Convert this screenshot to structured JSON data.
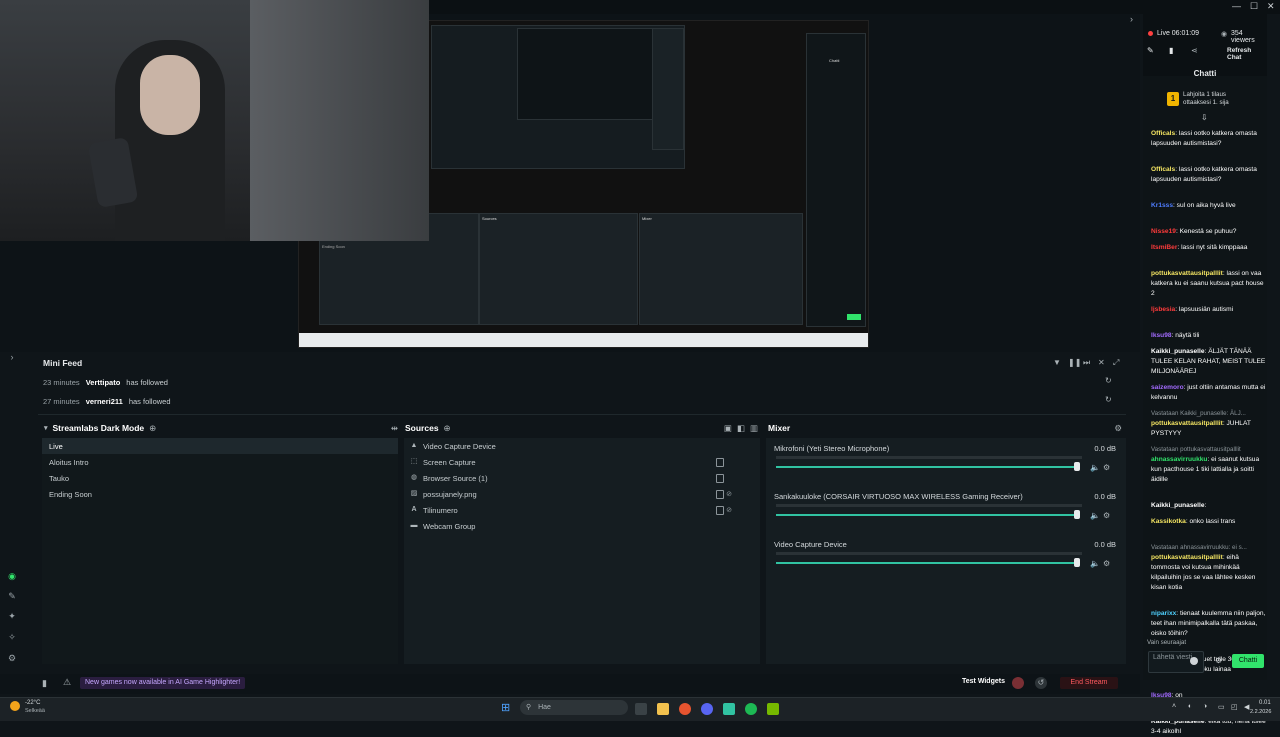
{
  "preview": {
    "thumb_scene_label": "Ending Soon",
    "thumb_sources_label": "Sources",
    "thumb_mixer_label": "Mixer",
    "thumb_chat_label": "Chatti"
  },
  "minifeed": {
    "title": "Mini Feed",
    "events": [
      {
        "time": "23 minutes",
        "name": "Verttipato",
        "action": "has followed"
      },
      {
        "time": "27 minutes",
        "name": "verneri211",
        "action": "has followed"
      }
    ]
  },
  "scenes": {
    "title": "Streamlabs Dark Mode",
    "items": [
      "Live",
      "Aloitus Intro",
      "Tauko",
      "Ending Soon"
    ]
  },
  "sources": {
    "title": "Sources",
    "items": [
      {
        "label": "Video Capture Device",
        "icon": "webcam-icon"
      },
      {
        "label": "Screen Capture",
        "icon": "screen-icon"
      },
      {
        "label": "Browser Source (1)",
        "icon": "browser-icon"
      },
      {
        "label": "possujanely.png",
        "icon": "image-icon"
      },
      {
        "label": "Tilinumero",
        "icon": "text-icon"
      },
      {
        "label": "Webcam Group",
        "icon": "folder-icon"
      }
    ]
  },
  "mixer": {
    "title": "Mixer",
    "channels": [
      {
        "name": "Mikrofoni (Yeti Stereo Microphone)",
        "db": "0.0 dB",
        "level": 0.98
      },
      {
        "name": "Sankakuuloke (CORSAIR VIRTUOSO MAX WIRELESS Gaming Receiver)",
        "db": "0.0 dB",
        "level": 0.98
      },
      {
        "name": "Video Capture Device",
        "db": "0.0 dB",
        "level": 0.98
      }
    ]
  },
  "bottombar": {
    "banner": "New games now available in AI Game Highlighter!",
    "test_widgets": "Test Widgets",
    "end_stream": "End Stream"
  },
  "chat": {
    "live": "Live 06:01:09",
    "viewers": "354 viewers",
    "refresh": "Refresh Chat",
    "title": "Chatti",
    "pinned_line1": "Lahjoita 1 tilaus",
    "pinned_line2": "ottaaksesi 1. sija",
    "messages": [
      {
        "user": "Officals",
        "color": "#f5e663",
        "text": "lassi ootko katkera omasta lapsuuden autismistasi?"
      },
      {
        "user": "Officals",
        "color": "#f5e663",
        "text": "lassi ootko katkera omasta lapsuuden autismistasi?"
      },
      {
        "user": "Kr1sss",
        "color": "#4f7dff",
        "text": "sul on aika hyvä live"
      },
      {
        "user": "Nisse19",
        "color": "#ff3b3b",
        "text": "Kenestä se puhuu?"
      },
      {
        "user": "ItsmiBer",
        "color": "#ff3b3b",
        "text": "lassi nyt sitä kimppaaa"
      },
      {
        "user": "pottukasvattausitpalllit",
        "color": "#f5e663",
        "text": "lassi on vaa katkera ku ei saanu kutsua pact house 2"
      },
      {
        "user": "ljsbesia",
        "color": "#ff3b3b",
        "text": "lapsuusiän autismi"
      },
      {
        "user": "Iksu98",
        "color": "#a36bff",
        "text": "näytä tili"
      },
      {
        "user": "Kaikki_punaselle",
        "color": "#ffffff",
        "text": "ÄLJÄT TÄNÄÄ TULEE KELAN RAHAT, MEIST TULEE MILJONÄÄREJ"
      },
      {
        "user": "saizemoro",
        "color": "#a36bff",
        "text": "just oltiin antamas mutta ei kelvannu"
      },
      {
        "user": "pottukasvattausitpalllit",
        "color": "#f5e663",
        "text": "JUHLAT PYSTYYY",
        "reply": "Vastataan Kaikki_punaselle: ÄLJ..."
      },
      {
        "user": "ahnassavirruukku",
        "color": "#31e36b",
        "text": "ei saanut kutsua kun pacthouse 1 tiki lattialla ja soitti äidille",
        "reply": "Vastataan pottukasvattausitpalllit"
      },
      {
        "user": "Kaikki_punaselle",
        "color": "#ffffff",
        "text": ""
      },
      {
        "user": "Kassikotka",
        "color": "#f5e663",
        "text": "onko lassi trans"
      },
      {
        "user": "pottukasvattausitpalllit",
        "color": "#f5e663",
        "text": "eihä tommosta voi kutsua mihinkää kilpailuihin jos se vaa lähtee kesken kisan kotia",
        "reply": "Vastataan ahnassavirruukku: ei s..."
      },
      {
        "user": "niparixx",
        "color": "#4fd1ff",
        "text": "tienaat kuulemma niin paljon, teet ihan minimipalkalla tätä paskaa, oisko töihin?"
      },
      {
        "user": "TanTTaXX",
        "color": "#ff3b3b",
        "text": "lassi tuet tulle 30 min päästä tilelle kyl joku lainaa"
      },
      {
        "user": "Iksu98",
        "color": "#a36bff",
        "text": "on"
      },
      {
        "user": "Kaikki_punaselle",
        "color": "#ffffff",
        "text": "eikä tuu, nehä tulee 3-4 aikolhl",
        "reply": "Vastataan TanTTaXX: lassi tuet t..."
      }
    ],
    "followers_only": "Vain seuraajat",
    "input_placeholder": "Lähetä viesti",
    "send": "Chatti"
  },
  "taskbar": {
    "weather_temp": "-22°C",
    "weather_desc": "Selkeää",
    "search": "Hae",
    "time": "0.01",
    "date": "2.2.2026"
  }
}
